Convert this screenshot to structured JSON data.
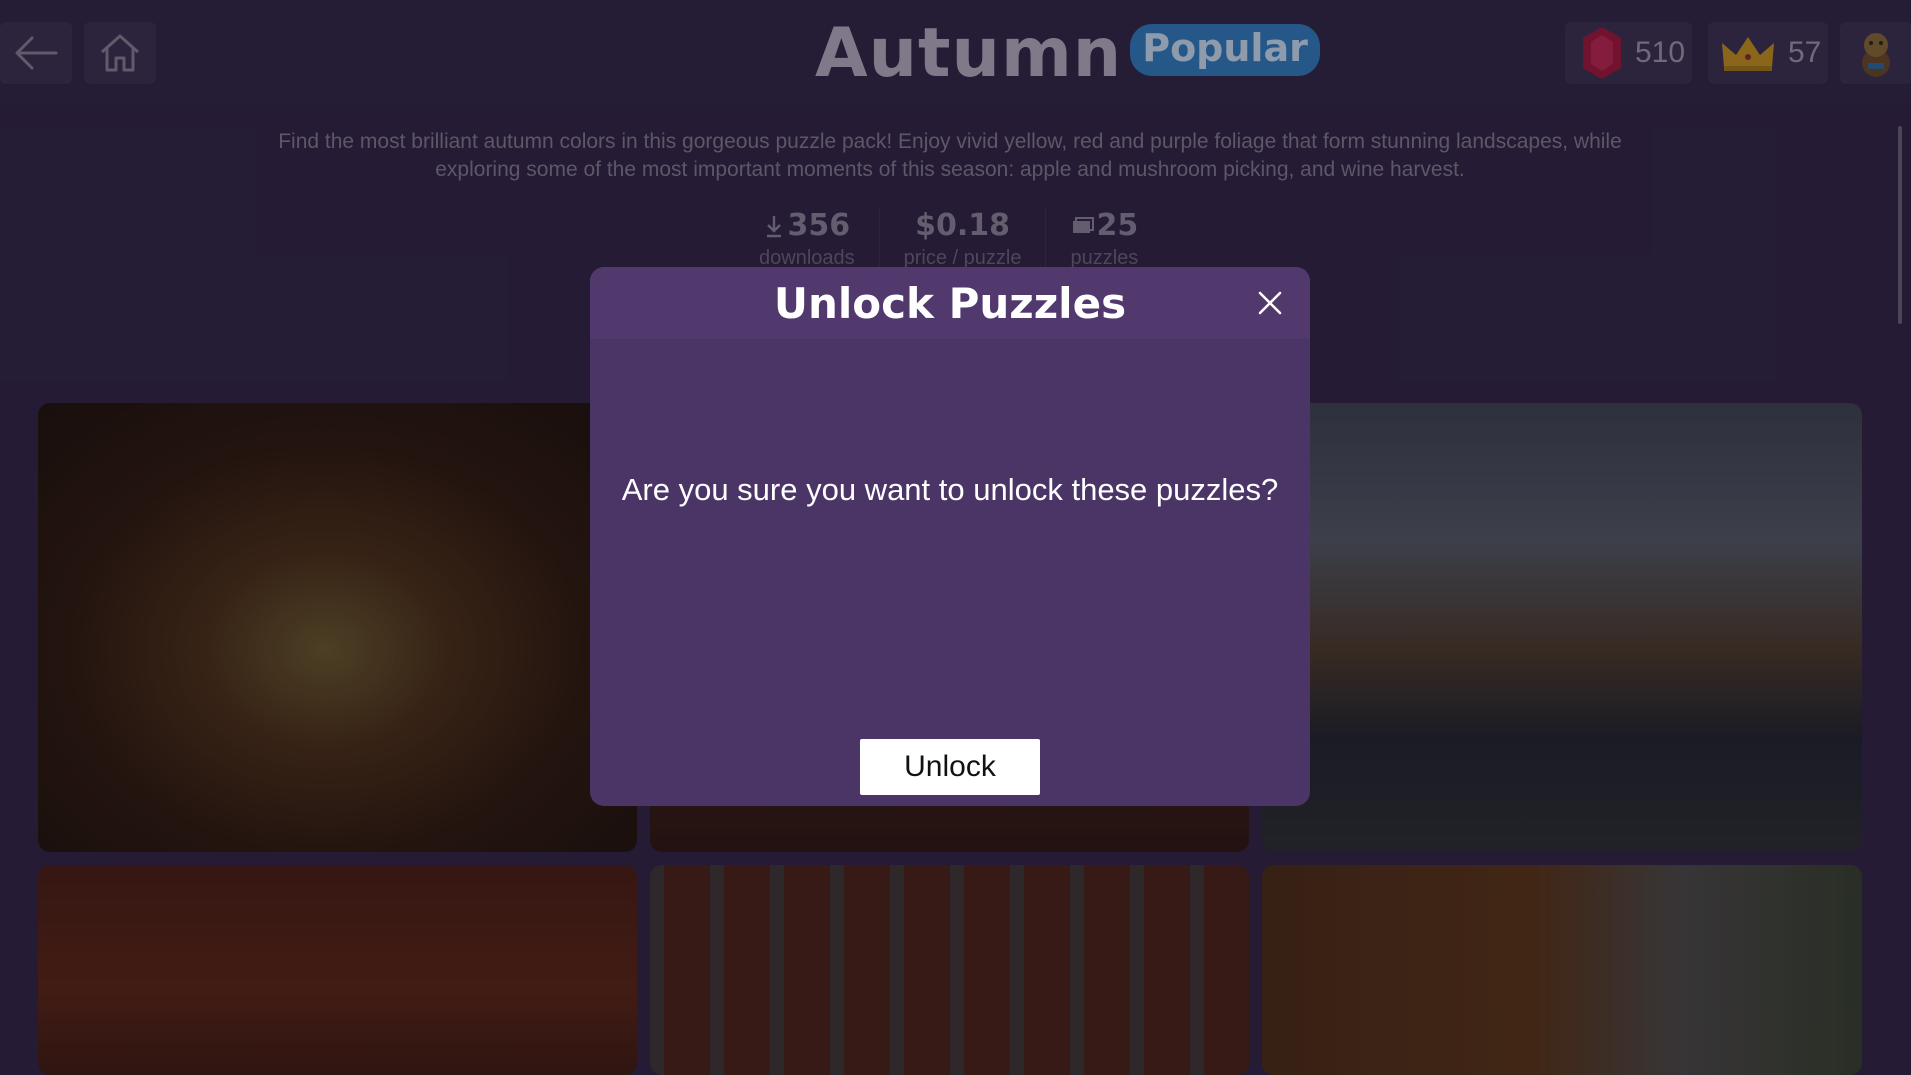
{
  "header": {
    "title": "Autumn",
    "badge": "Popular",
    "gems": "510",
    "crowns": "57"
  },
  "icons": {
    "back": "back-arrow-icon",
    "home": "home-icon",
    "gem": "gem-icon",
    "crown": "crown-icon",
    "avatar": "avatar-icon",
    "download": "download-icon",
    "puzzles": "puzzles-icon",
    "close": "close-icon"
  },
  "description": "Find the most brilliant autumn colors in this gorgeous puzzle pack! Enjoy vivid yellow, red and purple foliage that form stunning landscapes, while exploring some of the most important moments of this season: apple and mushroom picking, and wine harvest.",
  "stats": [
    {
      "value": "356",
      "label": "downloads"
    },
    {
      "value": "$0.18",
      "label": "price / puzzle"
    },
    {
      "value": "25",
      "label": "puzzles"
    }
  ],
  "dialog": {
    "title": "Unlock Puzzles",
    "message": "Are you sure you want to unlock these puzzles?",
    "button": "Unlock"
  },
  "colors": {
    "background": "#2e2341",
    "dialog": "#4a3566",
    "badge": "#2f7fc2",
    "gem": "#b3153c",
    "crown": "#d4a017"
  }
}
